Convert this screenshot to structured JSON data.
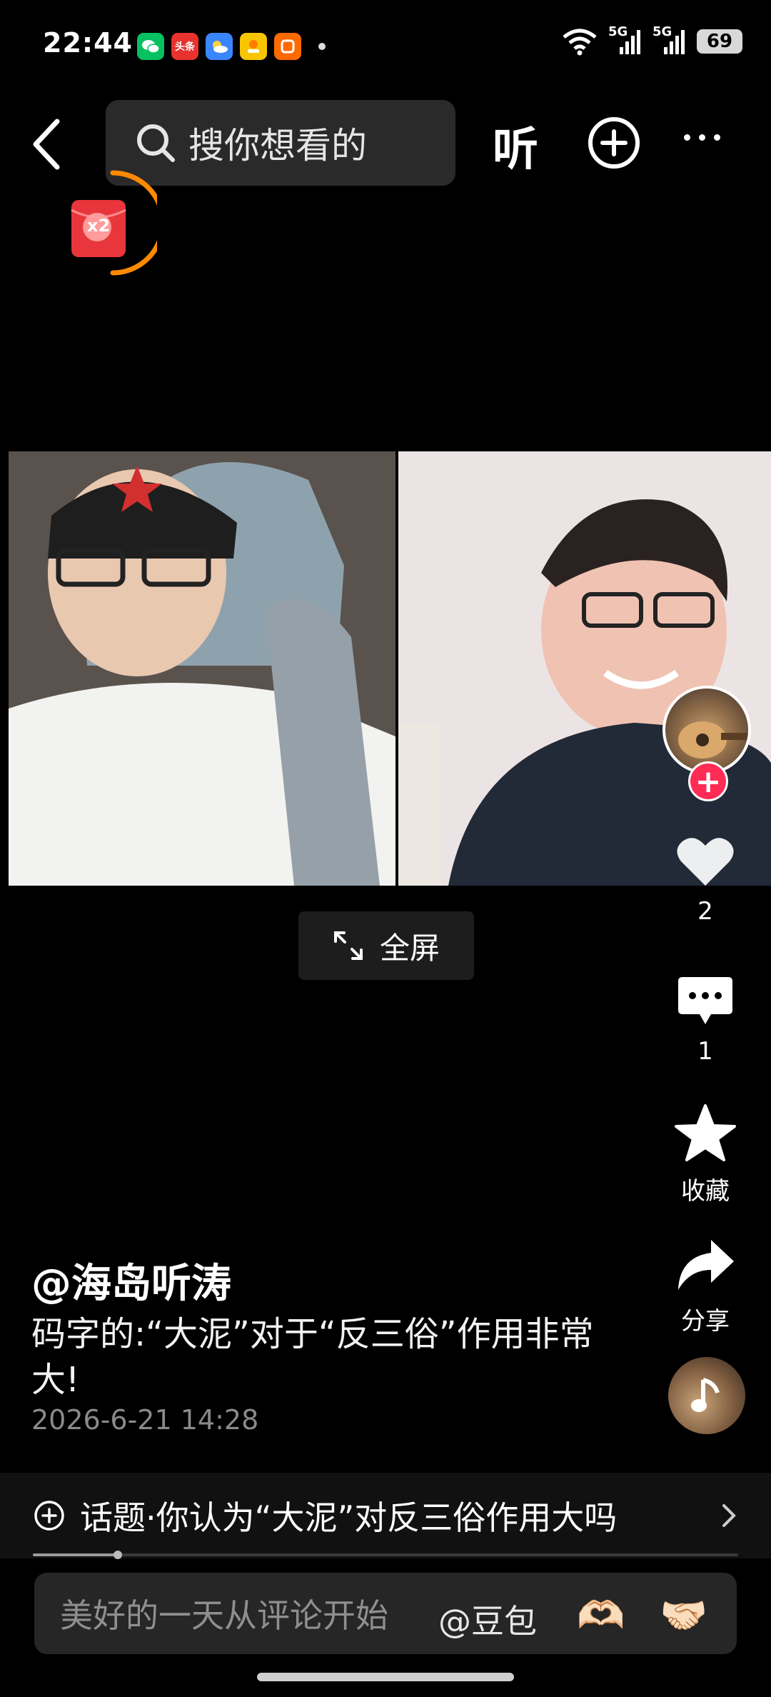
{
  "status_bar": {
    "time": "22:44",
    "app_icons": [
      {
        "name": "wechat-icon",
        "color": "#07c160",
        "label": ""
      },
      {
        "name": "toutiao-icon",
        "color": "#e8322d",
        "label": "头条"
      },
      {
        "name": "weather-icon",
        "color": "#3a86ff",
        "label": ""
      },
      {
        "name": "app-icon-yellow",
        "color": "#f7c600",
        "label": ""
      },
      {
        "name": "app-icon-orange",
        "color": "#ff6a00",
        "label": ""
      }
    ],
    "signal_labels": [
      "5G",
      "5G"
    ],
    "battery": "69"
  },
  "topnav": {
    "search_placeholder": "搜你想看的",
    "listen_label": "听"
  },
  "redpacket": {
    "label": "x2"
  },
  "fullscreen": {
    "label": "全屏"
  },
  "actions": {
    "likes": "2",
    "comments": "1",
    "favorite_label": "收藏",
    "share_label": "分享"
  },
  "post": {
    "author": "@海岛听涛",
    "description": "码字的:“大泥”对于“反三俗”作用非常大!",
    "date": "2026-6-21 14:28"
  },
  "topic": {
    "text": "话题·你认为“大泥”对反三俗作用大吗"
  },
  "progress": 0.12,
  "comment": {
    "placeholder": "美好的一天从评论开始",
    "mention": "@豆包",
    "emoji1": "🫶🏻",
    "emoji2": "🤝🏻"
  }
}
